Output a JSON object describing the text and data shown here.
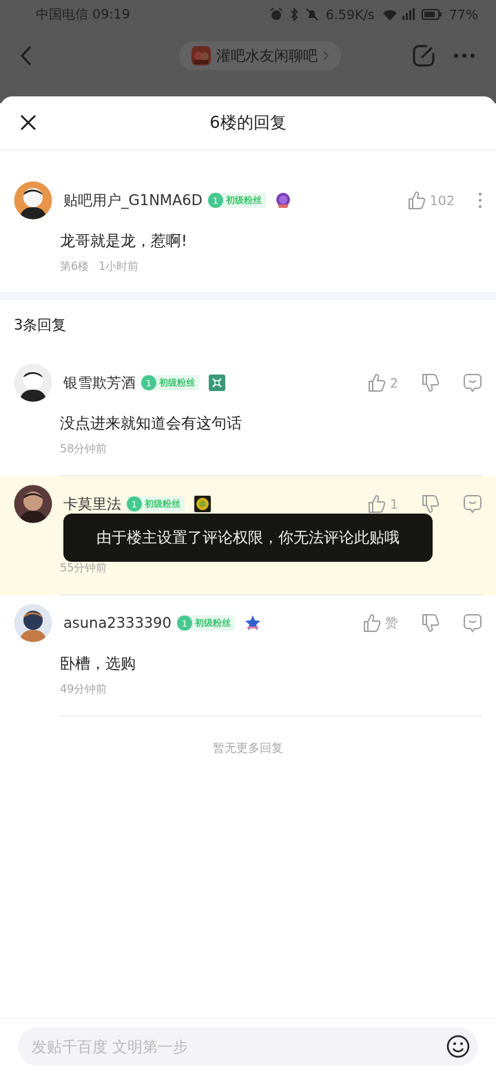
{
  "status_bar": {
    "carrier_time": "中国电信 09:19",
    "speed": "6.59K/s",
    "battery": "77%"
  },
  "nav": {
    "forum": "灌吧水友闲聊吧"
  },
  "sheet": {
    "title": "6楼的回复"
  },
  "post": {
    "user": "贴吧用户_G1NMA6D",
    "level": "1",
    "fan_title": "初级粉丝",
    "likes": "102",
    "text": "龙哥就是龙，惹啊!",
    "floor": "第6楼",
    "time": "1小时前"
  },
  "reply_count": "3条回复",
  "replies": [
    {
      "user": "银雪欺芳酒",
      "level": "1",
      "fan_title": "初级粉丝",
      "medal": {
        "kind": "square"
      },
      "likes": "2",
      "text": "没点进来就知道会有这句话",
      "time": "58分钟前",
      "highlighted": false
    },
    {
      "user": "卡莫里法",
      "level": "1",
      "fan_title": "初级粉丝",
      "medal": {
        "kind": "sun"
      },
      "likes": "1",
      "time": "55分钟前",
      "highlighted": true
    },
    {
      "user": "asuna2333390",
      "level": "1",
      "fan_title": "初级粉丝",
      "medal": {
        "kind": "star"
      },
      "likes": "赞",
      "text": "卧槽，选购",
      "time": "49分钟前",
      "highlighted": false
    }
  ],
  "end_note": "暂无更多回复",
  "toast": "由于楼主设置了评论权限，你无法评论此贴哦",
  "composer": {
    "placeholder": "发贴千百度 文明第一步"
  }
}
